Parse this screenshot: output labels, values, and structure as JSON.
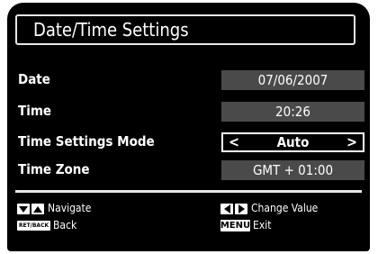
{
  "title": "Date/Time Settings",
  "rows": [
    {
      "label": "Date",
      "value": "07/06/2007"
    },
    {
      "label": "Time",
      "value": "20:26"
    },
    {
      "label": "Time Settings Mode",
      "value": "Auto",
      "left_arrow": "<",
      "right_arrow": ">"
    },
    {
      "label": "Time Zone",
      "value": "GMT + 01:00"
    }
  ],
  "legend": {
    "navigate": "Navigate",
    "back_key": "RET/BACK",
    "back": "Back",
    "change_value": "Change Value",
    "menu_key": "MENU",
    "exit": "Exit"
  },
  "colors": {
    "background": "#000000",
    "value_box": "#4a4a4a",
    "text": "#ffffff"
  }
}
